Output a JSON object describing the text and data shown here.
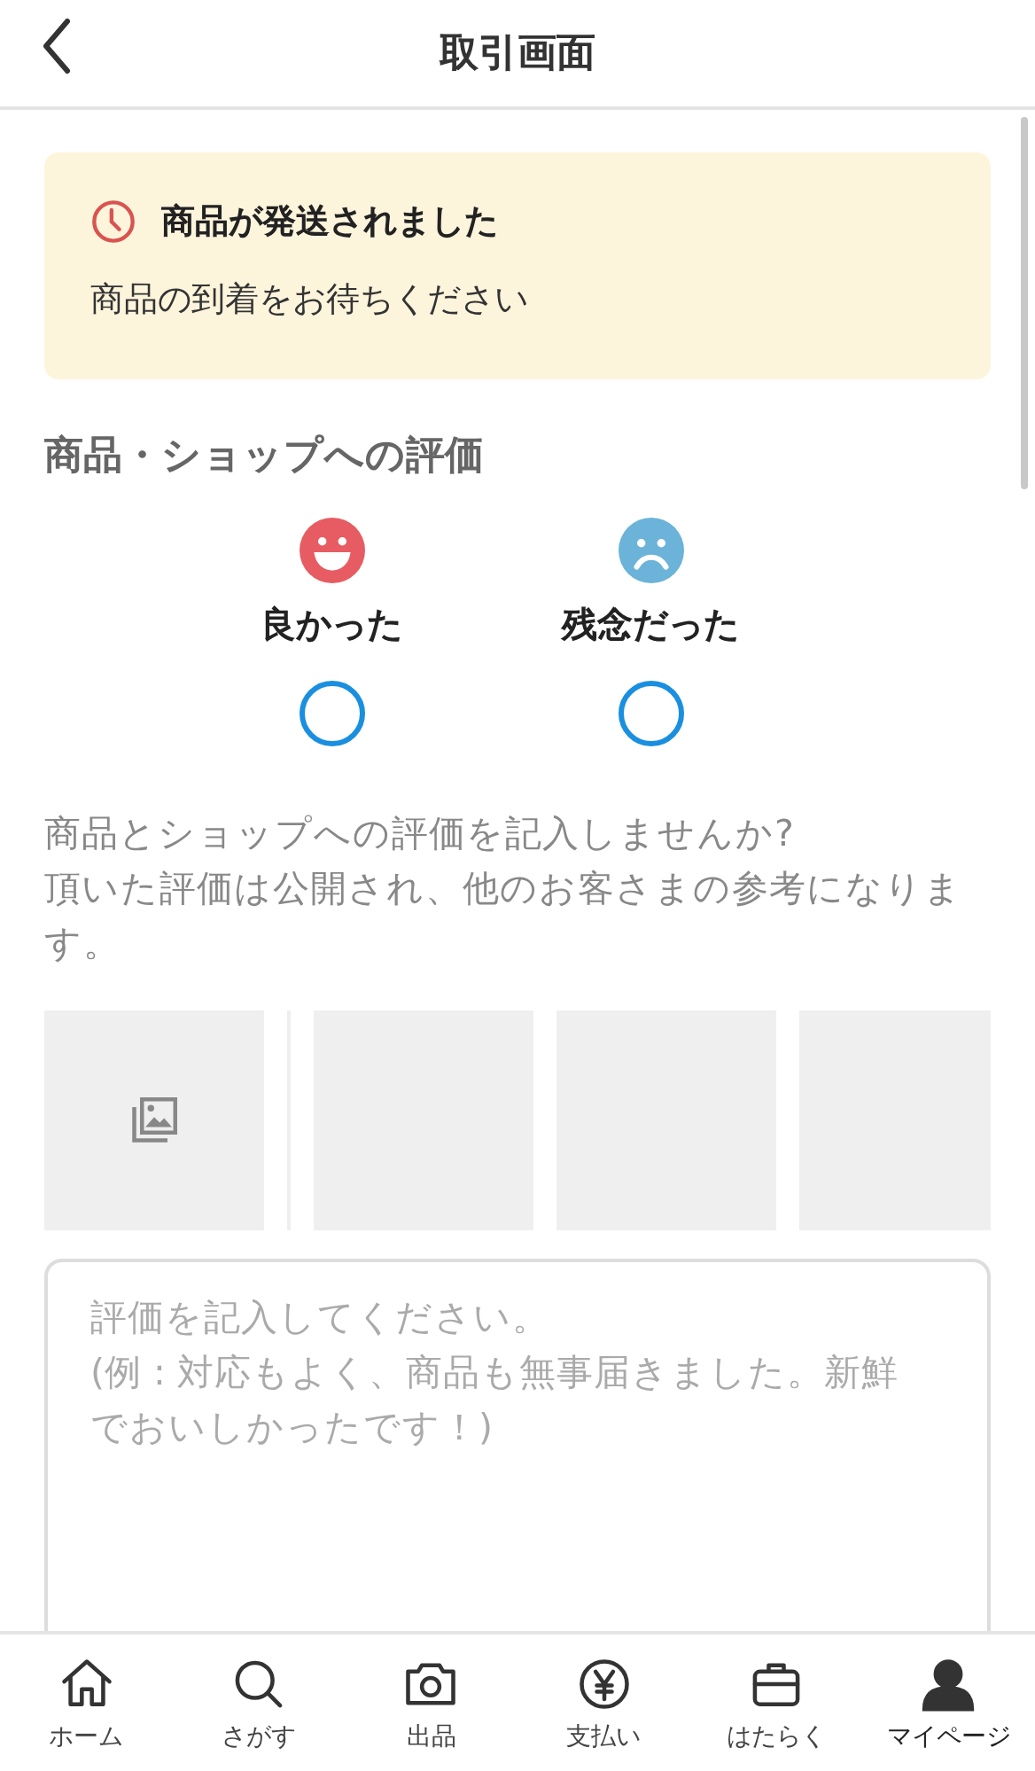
{
  "header": {
    "title": "取引画面"
  },
  "notice": {
    "title": "商品が発送されました",
    "message": "商品の到着をお待ちください"
  },
  "rating": {
    "title": "商品・ショップへの評価",
    "options": [
      {
        "kind": "good",
        "label": "良かった",
        "selected": false
      },
      {
        "kind": "bad",
        "label": "残念だった",
        "selected": false
      }
    ]
  },
  "prompt": "商品とショップへの評価を記入しませんか?\n頂いた評価は公開され、他のお客さまの参考になります。",
  "photos": [
    {
      "kind": "add"
    },
    {
      "kind": "empty"
    },
    {
      "kind": "empty"
    },
    {
      "kind": "empty"
    }
  ],
  "review": {
    "placeholder": "評価を記入してください。\n(例 : 対応もよく、商品も無事届きました。新鮮でおいしかったです！)"
  },
  "nav": [
    {
      "kind": "home",
      "label": "ホーム",
      "selected": false
    },
    {
      "kind": "search",
      "label": "さがす",
      "selected": false
    },
    {
      "kind": "camera",
      "label": "出品",
      "selected": false
    },
    {
      "kind": "pay",
      "label": "支払い",
      "selected": false
    },
    {
      "kind": "work",
      "label": "はたらく",
      "selected": false
    },
    {
      "kind": "user",
      "label": "マイページ",
      "selected": true
    }
  ]
}
